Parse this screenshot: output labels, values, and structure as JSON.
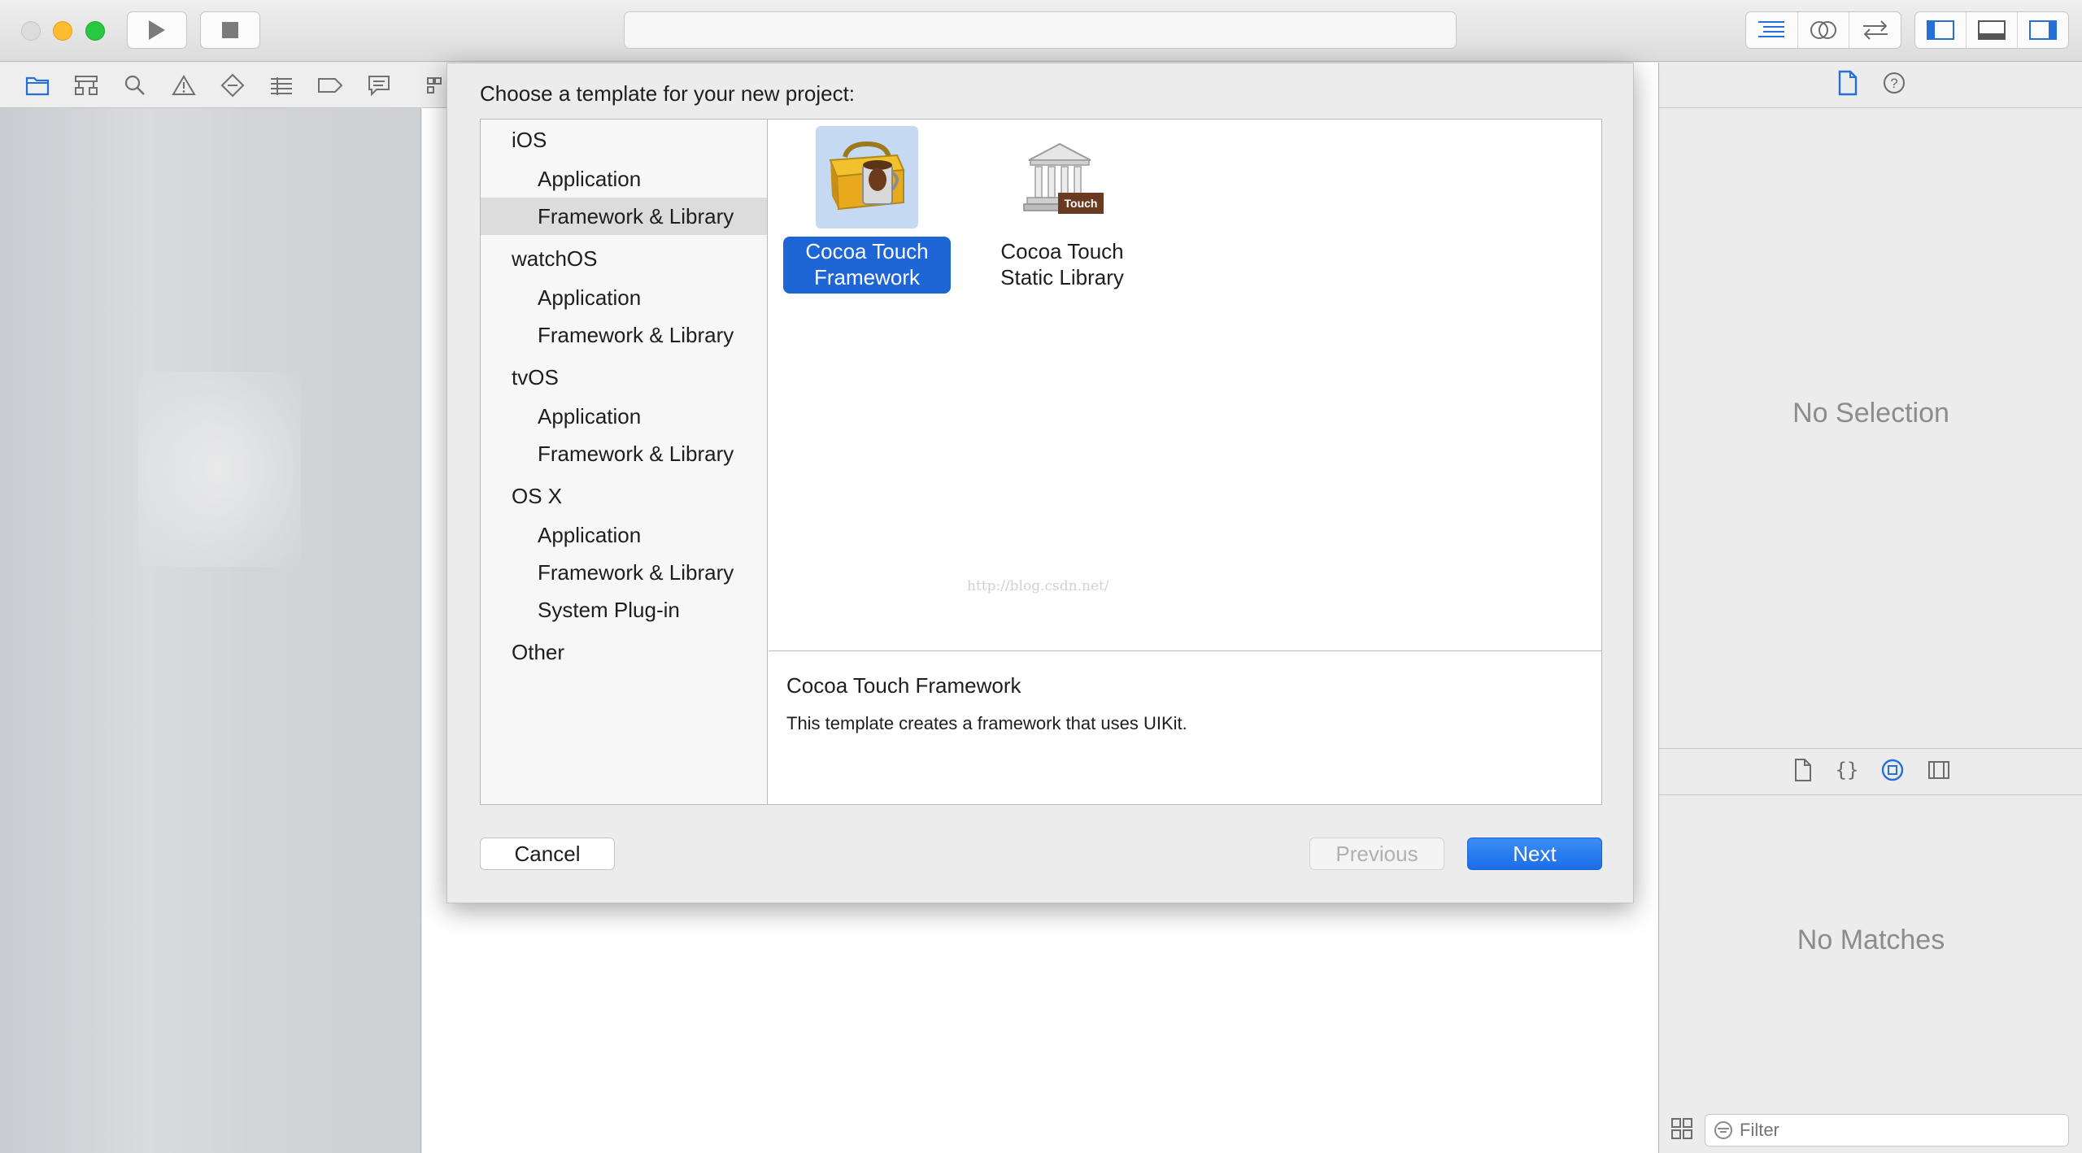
{
  "toolbar": {
    "run_icon": "play-icon",
    "stop_icon": "stop-icon",
    "activity_text": ""
  },
  "navigator": {
    "icons": [
      "folder-icon",
      "hierarchy-icon",
      "search-icon",
      "warning-icon",
      "test-icon",
      "debug-icon",
      "breakpoint-icon",
      "report-icon"
    ]
  },
  "sheet": {
    "title": "Choose a template for your new project:",
    "categories": [
      {
        "label": "iOS",
        "kind": "platform"
      },
      {
        "label": "Application",
        "kind": "sub"
      },
      {
        "label": "Framework & Library",
        "kind": "sub",
        "selected": true
      },
      {
        "label": "watchOS",
        "kind": "platform"
      },
      {
        "label": "Application",
        "kind": "sub"
      },
      {
        "label": "Framework & Library",
        "kind": "sub"
      },
      {
        "label": "tvOS",
        "kind": "platform"
      },
      {
        "label": "Application",
        "kind": "sub"
      },
      {
        "label": "Framework & Library",
        "kind": "sub"
      },
      {
        "label": "OS X",
        "kind": "platform"
      },
      {
        "label": "Application",
        "kind": "sub"
      },
      {
        "label": "Framework & Library",
        "kind": "sub"
      },
      {
        "label": "System Plug-in",
        "kind": "sub"
      },
      {
        "label": "Other",
        "kind": "platform"
      }
    ],
    "templates": [
      {
        "line1": "Cocoa Touch",
        "line2": "Framework",
        "icon": "toolbox-icon",
        "selected": true
      },
      {
        "line1": "Cocoa Touch",
        "line2": "Static Library",
        "icon": "library-building-icon",
        "badge": "Touch",
        "selected": false
      }
    ],
    "watermark": "http://blog.csdn.net/",
    "description": {
      "title": "Cocoa Touch Framework",
      "text": "This template creates a framework that uses UIKit."
    },
    "buttons": {
      "cancel": "Cancel",
      "previous": "Previous",
      "next": "Next"
    }
  },
  "inspector": {
    "no_selection": "No Selection",
    "no_matches": "No Matches",
    "filter_placeholder": "Filter"
  },
  "colors": {
    "accent": "#1e65d6",
    "selection_bg": "#c5d9f2"
  }
}
